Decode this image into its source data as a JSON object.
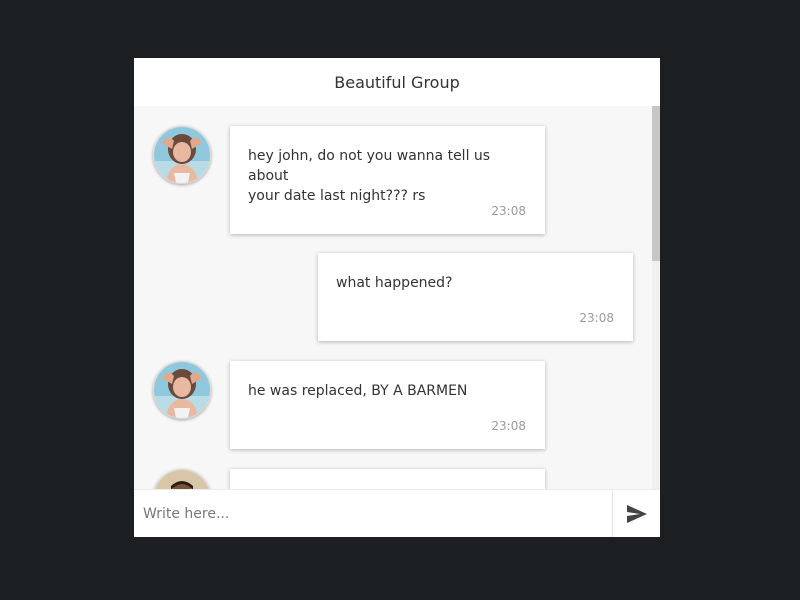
{
  "header": {
    "title": "Beautiful Group"
  },
  "messages": [
    {
      "side": "left",
      "avatar": "woman-avatar",
      "text": "hey john, do not you wanna tell us about\nyour date last night??? rs",
      "time": "23:08"
    },
    {
      "side": "right",
      "text": "what happened?",
      "time": "23:08"
    },
    {
      "side": "left",
      "avatar": "woman-avatar",
      "text": "he was replaced, BY A BARMEN",
      "time": "23:08"
    },
    {
      "side": "left",
      "avatar": "man-avatar",
      "text": "",
      "time": ""
    }
  ],
  "composer": {
    "placeholder": "Write here...",
    "send_icon": "send-icon"
  },
  "colors": {
    "background": "#1c1f22",
    "panel": "#f7f7f7",
    "bubble": "#ffffff"
  }
}
